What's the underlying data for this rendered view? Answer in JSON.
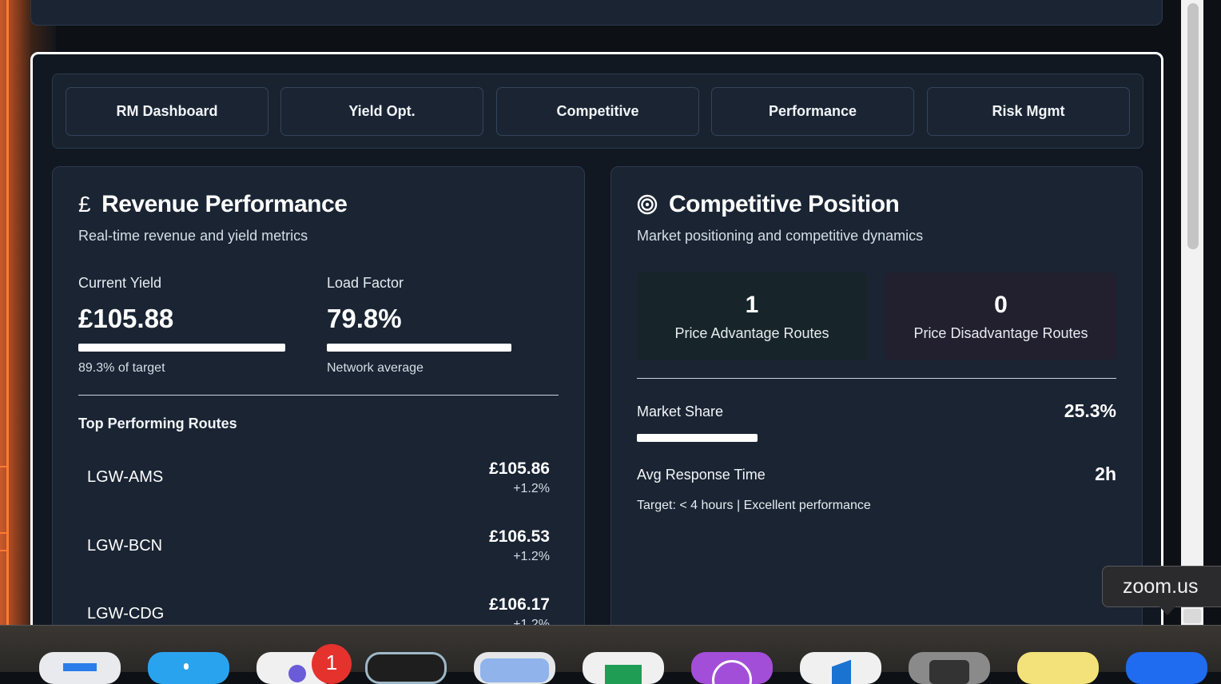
{
  "tabs": [
    "RM Dashboard",
    "Yield Opt.",
    "Competitive",
    "Performance",
    "Risk Mgmt"
  ],
  "revenue": {
    "icon": "pound-icon",
    "icon_glyph": "£",
    "title": "Revenue Performance",
    "subtitle": "Real-time revenue and yield metrics",
    "current_yield": {
      "label": "Current Yield",
      "value": "£105.88",
      "note": "89.3% of target",
      "progress": 0.893
    },
    "load_factor": {
      "label": "Load Factor",
      "value": "79.8%",
      "note": "Network average",
      "progress": 0.798
    },
    "routes_title": "Top Performing Routes",
    "routes": [
      {
        "name": "LGW-AMS",
        "price": "£105.86",
        "change": "+1.2%"
      },
      {
        "name": "LGW-BCN",
        "price": "£106.53",
        "change": "+1.2%"
      },
      {
        "name": "LGW-CDG",
        "price": "£106.17",
        "change": "+1.2%"
      }
    ]
  },
  "competitive": {
    "icon": "target-icon",
    "title": "Competitive Position",
    "subtitle": "Market positioning and competitive dynamics",
    "advantage": {
      "value": "1",
      "label": "Price Advantage Routes",
      "color": "#17252a"
    },
    "disadvantage": {
      "value": "0",
      "label": "Price Disadvantage Routes",
      "color": "#221f2e"
    },
    "market_share": {
      "label": "Market Share",
      "value": "25.3%",
      "progress": 0.253
    },
    "response_time": {
      "label": "Avg Response Time",
      "value": "2h"
    },
    "target_note": "Target: < 4 hours | Excellent performance"
  },
  "tooltip": "zoom.us",
  "dock": {
    "badge": "1",
    "icons": [
      {
        "name": "finder-icon",
        "color": "#e8eaed"
      },
      {
        "name": "mail-app-icon",
        "color": "#e8eaed"
      },
      {
        "name": "teams-icon",
        "color": "#2aa3ef"
      },
      {
        "name": "messenger-icon",
        "color": "#f0f0f0"
      },
      {
        "name": "terminal-icon",
        "color": "#1e1e1e"
      },
      {
        "name": "preview-icon",
        "color": "#e4e6ea"
      },
      {
        "name": "numbers-icon",
        "color": "#f0f0f0"
      },
      {
        "name": "podcasts-icon",
        "color": "#a24ed8"
      },
      {
        "name": "outlook-icon",
        "color": "#f0f0f0"
      },
      {
        "name": "calculator-icon",
        "color": "#8a8a8a"
      },
      {
        "name": "notes-icon",
        "color": "#f3e27a"
      },
      {
        "name": "zoom-icon",
        "color": "#1f6cf0"
      }
    ]
  }
}
